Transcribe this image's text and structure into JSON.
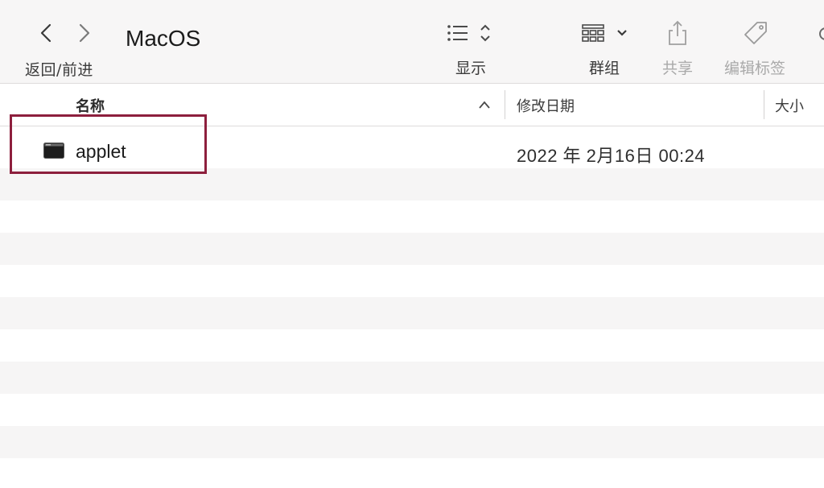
{
  "toolbar": {
    "nav_label": "返回/前进",
    "folder_title": "MacOS",
    "view_label": "显示",
    "group_label": "群组",
    "share_label": "共享",
    "tags_label": "编辑标签"
  },
  "columns": {
    "name": "名称",
    "date_modified": "修改日期",
    "size": "大小"
  },
  "files": [
    {
      "name": "applet",
      "date_modified": "2022 年 2月16日 00:24"
    }
  ],
  "colors": {
    "highlight": "#8d1f3d",
    "toolbar_bg": "#f7f6f6",
    "row_alt": "#f6f5f5"
  }
}
